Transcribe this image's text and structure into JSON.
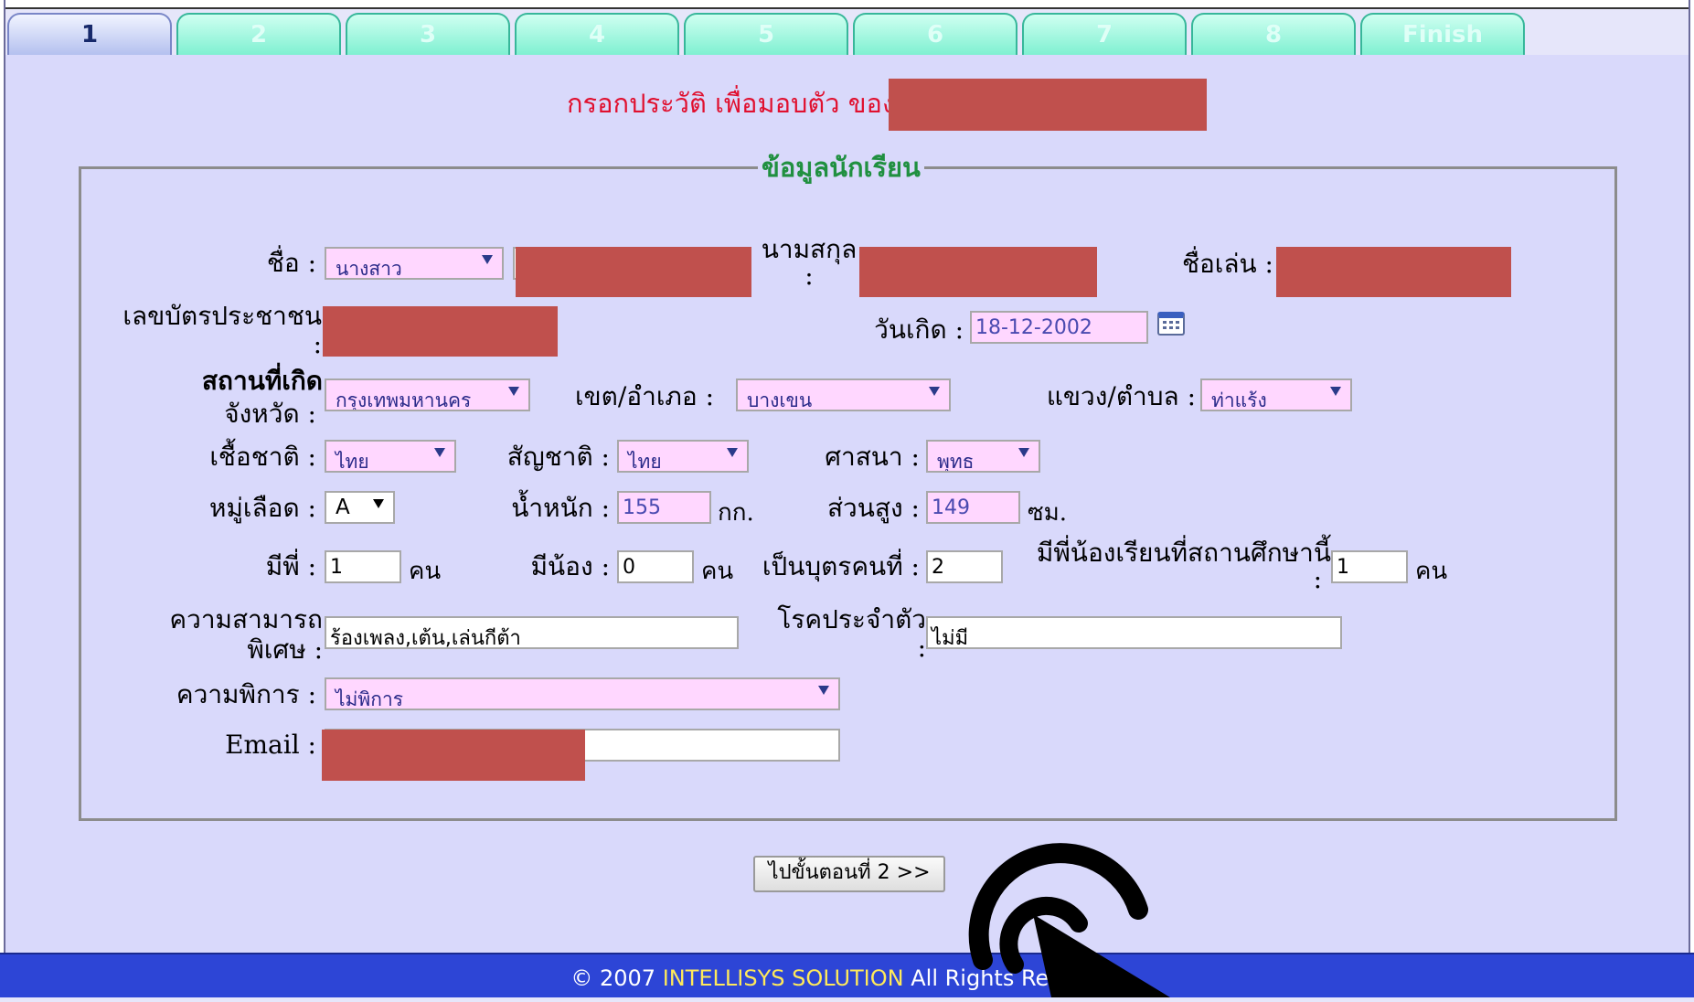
{
  "tabs": [
    "1",
    "2",
    "3",
    "4",
    "5",
    "6",
    "7",
    "8",
    "Finish"
  ],
  "heading": "กรอกประวัติ เพื่อมอบตัว ของ",
  "section_title": "ข้อมูลนักเรียน",
  "labels": {
    "first_name": "ชื่อ :",
    "last_name_line1": "นามสกุล",
    "last_name_line2": ":",
    "nickname": "ชื่อเล่น :",
    "id_card_line1": "เลขบัตรประชาชน",
    "id_card_line2": ":",
    "birthdate": "วันเกิด :",
    "birthplace_line1": "สถานที่เกิด",
    "birthplace_line2": "จังหวัด :",
    "district": "เขต/อำเภอ :",
    "subdistrict": "แขวง/ตำบล :",
    "race": "เชื้อชาติ :",
    "nationality": "สัญชาติ :",
    "religion": "ศาสนา :",
    "blood_group": "หมู่เลือด :",
    "weight": "น้ำหนัก :",
    "height": "ส่วนสูง :",
    "older_siblings": "มีพี่ :",
    "younger_siblings": "มีน้อง :",
    "child_order": "เป็นบุตรคนที่ :",
    "siblings_school_line1": "มีพี่น้องเรียนที่สถานศึกษานี้",
    "siblings_school_line2": ":",
    "special_ability_line1": "ความสามารถ",
    "special_ability_line2": "พิเศษ :",
    "disease_line1": "โรคประจำตัว",
    "disease_line2": ":",
    "disability": "ความพิการ :",
    "email": "Email :"
  },
  "units": {
    "weight": "กก.",
    "height": "ซม.",
    "person": "คน"
  },
  "values": {
    "title": "นางสาว",
    "birthdate": "18-12-2002",
    "province": "กรุงเทพมหานคร",
    "district": "บางเขน",
    "subdistrict": "ท่าแร้ง",
    "race": "ไทย",
    "nationality": "ไทย",
    "religion": "พุทธ",
    "blood_group": "A",
    "weight": "155",
    "height": "149",
    "older_siblings": "1",
    "younger_siblings": "0",
    "child_order": "2",
    "siblings_school": "1",
    "special_ability": "ร้องเพลง,เต้น,เล่นกีต้า",
    "disease": "ไม่มี",
    "disability": "ไม่พิการ"
  },
  "next_button": "ไปขั้นตอนที่ 2 >>",
  "footer": {
    "prefix": "© 2007",
    "brand": "INTELLISYS SOLUTION",
    "suffix": "All Rights Reserved"
  },
  "colors": {
    "heading": "#e0102f",
    "section_title": "#209040",
    "redaction": "#c0504d",
    "footer_bg": "#2d45d6"
  }
}
